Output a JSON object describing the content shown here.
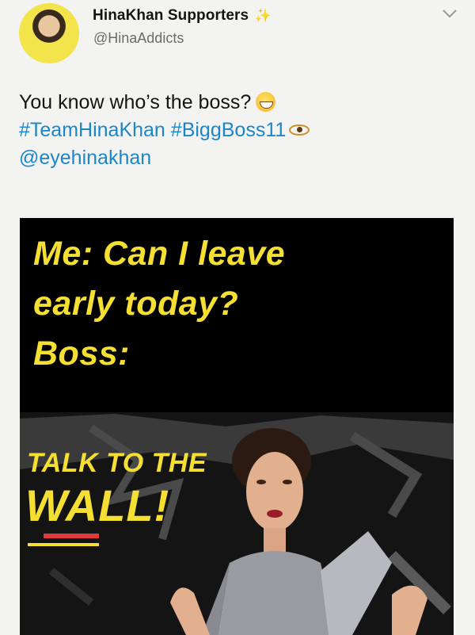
{
  "header": {
    "display_name": "HinaKhan Supporters",
    "handle": "@HinaAddicts",
    "name_emoji": "sparkles-icon"
  },
  "tweet": {
    "text_line1": "You know who’s the boss?",
    "hashtag1": "#TeamHinaKhan",
    "hashtag2": "#BiggBoss11",
    "mention": "@eyehinakhan"
  },
  "meme": {
    "caption_line1": "Me: Can I leave",
    "caption_line2": "early today?",
    "caption_line3": "Boss:",
    "poster_line1": "TALK TO THE",
    "poster_line2": "WALL!"
  },
  "colors": {
    "link": "#1b86c9",
    "meme_yellow": "#f5df32",
    "meme_background": "#000000",
    "page_background": "#f3f3f1"
  }
}
